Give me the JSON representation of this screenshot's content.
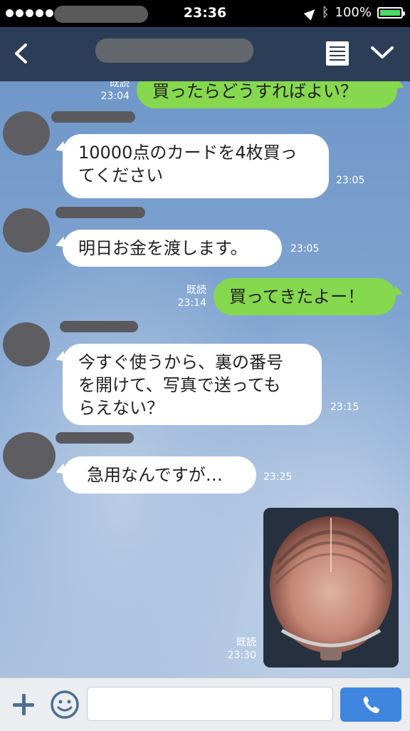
{
  "status_bar": {
    "time": "23:36",
    "battery_text": "100%",
    "battery_level": 1.0,
    "icons": [
      "signal-dots-icon",
      "location-arrow-icon",
      "bluetooth-icon",
      "battery-icon"
    ]
  },
  "header": {
    "icons": [
      "back-chevron-icon",
      "notes-icon",
      "chevron-down-icon"
    ]
  },
  "messages": [
    {
      "side": "out",
      "text": "買ったらどうすればよい？",
      "read": "既読",
      "time": "23:04"
    },
    {
      "side": "in",
      "lines": [
        "10000点のカードを4枚買っ",
        "てください"
      ],
      "time": "23:05"
    },
    {
      "side": "in",
      "text": "明日お金を渡します。",
      "time": "23:05"
    },
    {
      "side": "out",
      "text": "買ってきたよー！",
      "read": "既読",
      "time": "23:14"
    },
    {
      "side": "in",
      "lines": [
        "今すぐ使うから、裏の番号",
        "を開けて、写真で送っても",
        "らえない？"
      ],
      "time": "23:15"
    },
    {
      "side": "in",
      "text": "急用なんですが…",
      "time": "23:25"
    },
    {
      "side": "out",
      "type": "photo",
      "read": "既読",
      "time": "23:30"
    }
  ],
  "input": {
    "placeholder": "",
    "icons": [
      "plus-icon",
      "smiley-icon",
      "phone-icon"
    ]
  },
  "colors": {
    "header_bg": "#2c3d57",
    "outgoing_bubble": "#86d84e",
    "incoming_bubble": "#ffffff",
    "call_button": "#3e86e0"
  }
}
